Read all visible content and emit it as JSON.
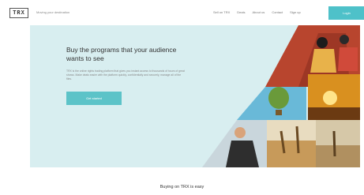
{
  "header": {
    "logo": "TRX",
    "tagline": "Moving your destination",
    "nav": [
      "Sell on TRX",
      "Deals",
      "About us",
      "Contact",
      "Sign up"
    ],
    "login_label": "Login"
  },
  "hero": {
    "title": "Buy the programs that your audience wants to see",
    "description": "TRX is the online rights trading platform that gives you instant access to thousands of hours of great shows. Make deals easier with the platform quickly, confidentially and securely, manage all of the files.",
    "cta_label": "Get started"
  },
  "section": {
    "heading": "Buying on TRX is easy"
  },
  "colors": {
    "accent": "#5cc3c8",
    "hero_bg": "#d8eef0"
  }
}
